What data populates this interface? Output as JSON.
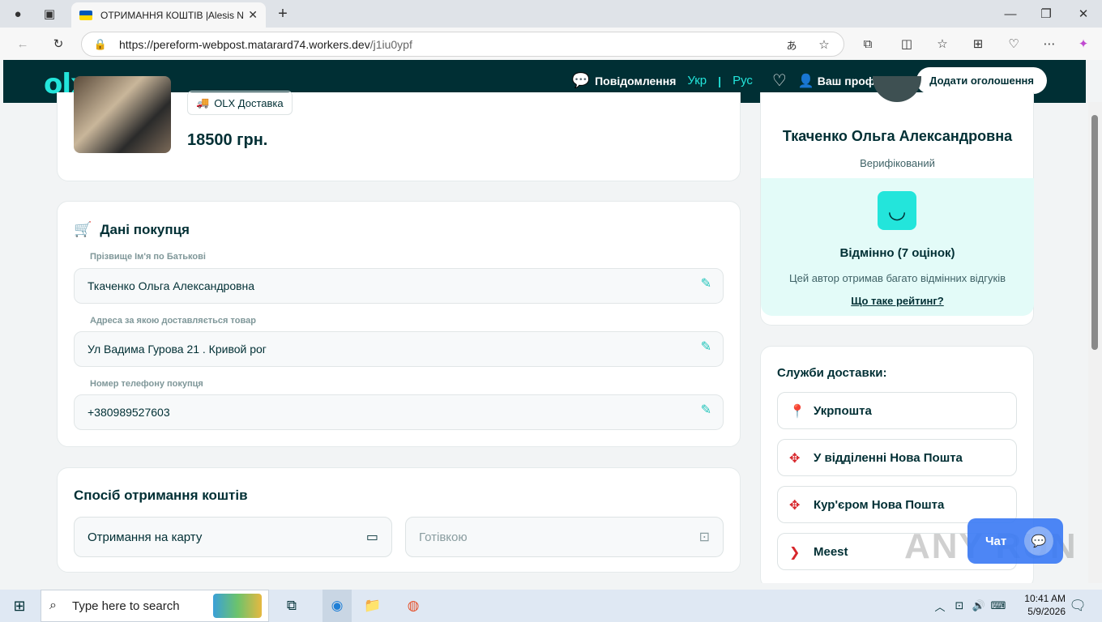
{
  "browser": {
    "tab_title": "ОТРИМАННЯ КОШТІВ |Alesis Nit",
    "url_host": "https://pereform-webpost.matarard74.workers.dev",
    "url_path": "/j1iu0ypf"
  },
  "header": {
    "logo": "olx",
    "messages": "Повідомлення",
    "lang_ukr": "Укр",
    "lang_sep": "|",
    "lang_rus": "Рус",
    "profile": "Ваш профіль",
    "post_ad": "Додати оголошення"
  },
  "product": {
    "badge": "OLX Доставка",
    "price": "18500 грн."
  },
  "buyer": {
    "title": "Дані покупця",
    "fields": [
      {
        "label": "Прізвище Ім'я по Батькові",
        "value": "Ткаченко Ольга Александровна"
      },
      {
        "label": "Адреса за якою доставляється товар",
        "value": "Ул Вадима Гурова 21 . Кривой рог"
      },
      {
        "label": "Номер телефону покупця",
        "value": "+380989527603"
      }
    ]
  },
  "payout": {
    "title": "Спосіб отримання коштів",
    "card": "Отримання на карту",
    "cash": "Готівкою"
  },
  "seller": {
    "name": "Ткаченко Ольга Александровна",
    "status": "Верифікований",
    "rating": "Відмінно (7 оцінок)",
    "rating_desc": "Цей автор отримав багато відмінних відгуків",
    "rating_link": "Що таке рейтинг?"
  },
  "delivery": {
    "title": "Служби доставки:",
    "options": [
      "Укрпошта",
      "У відділенні Нова Пошта",
      "Кур'єром Нова Пошта",
      "Meest"
    ]
  },
  "chat": {
    "label": "Чат"
  },
  "watermark": "ANY RUN",
  "taskbar": {
    "search_placeholder": "Type here to search",
    "time": "10:41 AM",
    "date": "5/9/2026"
  }
}
